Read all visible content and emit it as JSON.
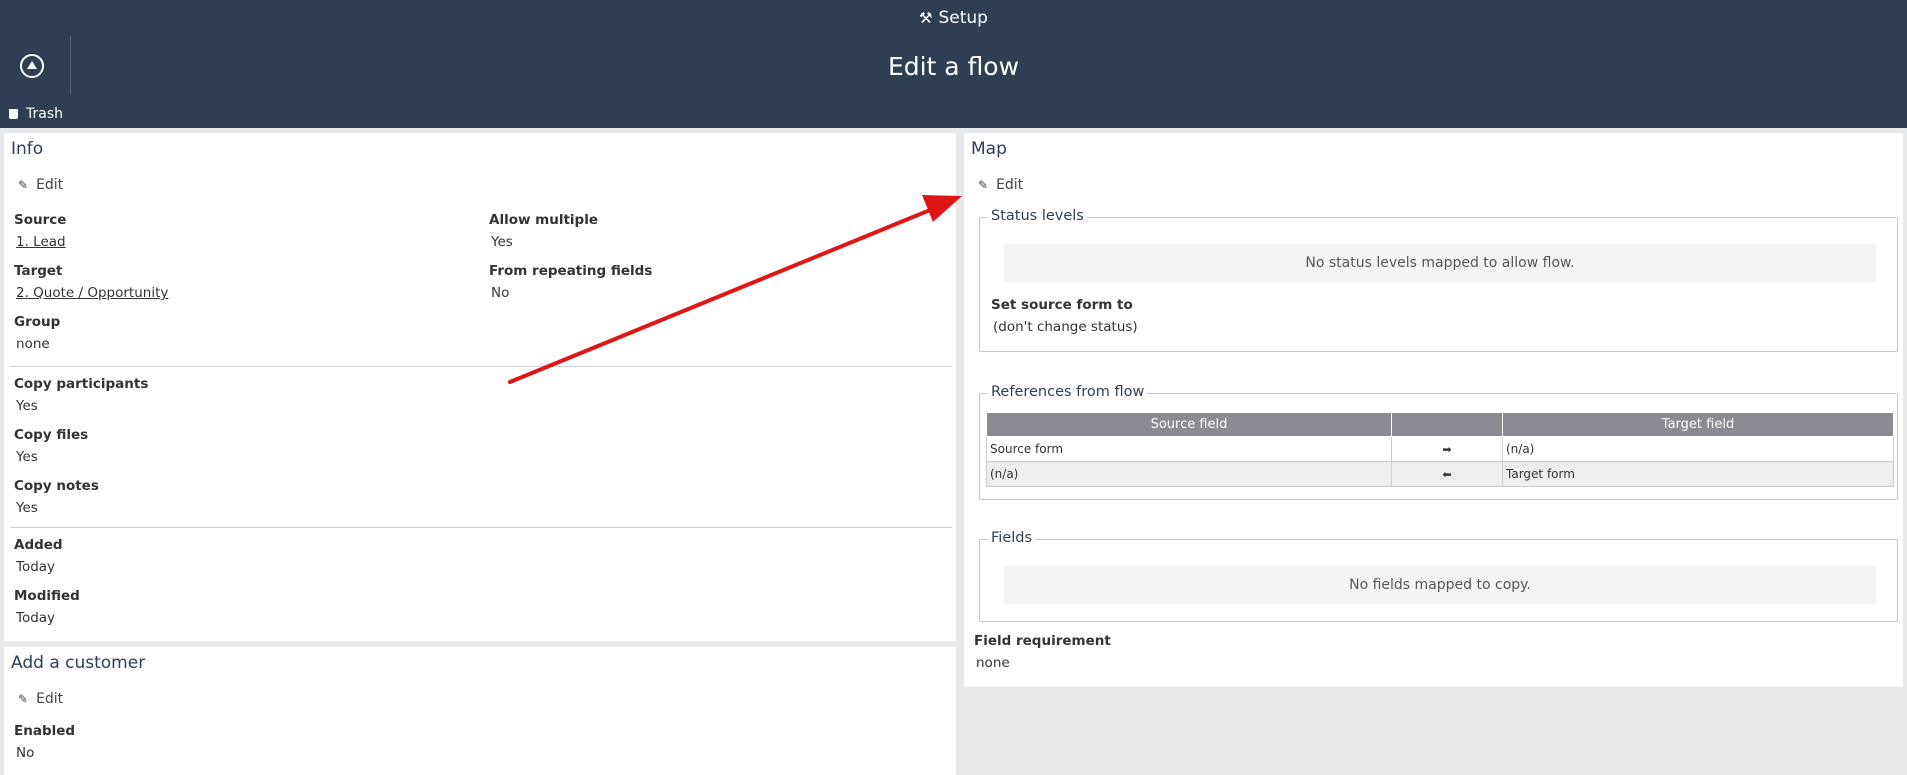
{
  "header": {
    "setup_label": "Setup",
    "page_title": "Edit a flow",
    "trash_label": "Trash"
  },
  "info": {
    "title": "Info",
    "edit_label": "Edit",
    "source_label": "Source",
    "source_value": "1. Lead",
    "target_label": "Target",
    "target_value": "2. Quote / Opportunity",
    "group_label": "Group",
    "group_value": "none",
    "allow_multiple_label": "Allow multiple",
    "allow_multiple_value": "Yes",
    "repeating_label": "From repeating fields",
    "repeating_value": "No",
    "copy_participants_label": "Copy participants",
    "copy_participants_value": "Yes",
    "copy_files_label": "Copy files",
    "copy_files_value": "Yes",
    "copy_notes_label": "Copy notes",
    "copy_notes_value": "Yes",
    "added_label": "Added",
    "added_value": "Today",
    "modified_label": "Modified",
    "modified_value": "Today"
  },
  "customer": {
    "title": "Add a customer",
    "edit_label": "Edit",
    "enabled_label": "Enabled",
    "enabled_value": "No"
  },
  "map": {
    "title": "Map",
    "edit_label": "Edit",
    "status_legend": "Status levels",
    "status_empty": "No status levels mapped to allow flow.",
    "set_source_label": "Set source form to",
    "set_source_value": "(don't change status)",
    "refs_legend": "References from flow",
    "refs_headers": [
      "Source field",
      "",
      "Target field"
    ],
    "refs_rows": [
      {
        "source": "Source form",
        "dir": "right",
        "target": "(n/a)"
      },
      {
        "source": "(n/a)",
        "dir": "left",
        "target": "Target form"
      }
    ],
    "fields_legend": "Fields",
    "fields_empty": "No fields mapped to copy.",
    "requirement_label": "Field requirement",
    "requirement_value": "none"
  },
  "annotation": {
    "color": "#e01515"
  }
}
